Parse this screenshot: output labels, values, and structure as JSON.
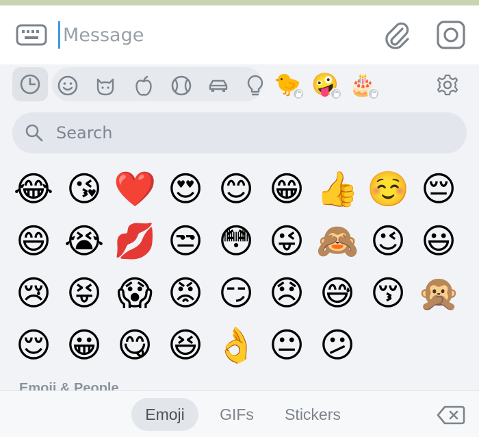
{
  "input": {
    "placeholder": "Message",
    "value": ""
  },
  "categories": {
    "recent_icon": "clock-icon",
    "items": [
      "smiley-icon",
      "cat-icon",
      "apple-icon",
      "ball-icon",
      "car-icon",
      "lightbulb-icon"
    ],
    "packs": [
      {
        "name": "duck-pack",
        "glyph": "🐤",
        "locked": true
      },
      {
        "name": "blob-pack",
        "glyph": "🤪",
        "locked": true
      },
      {
        "name": "happy-bday-pack",
        "glyph": "🎂",
        "locked": true
      }
    ]
  },
  "search": {
    "placeholder": "Search"
  },
  "emojis": [
    "😂",
    "😘",
    "❤️",
    "😍",
    "😊",
    "😁",
    "👍",
    "☺️",
    "😔",
    "😄",
    "😭",
    "💋",
    "😒",
    "😳",
    "😜",
    "🙈",
    "😉",
    "😃",
    "😢",
    "😝",
    "😱",
    "😡",
    "😏",
    "😞",
    "😅",
    "😚",
    "🙊",
    "😌",
    "😀",
    "😋",
    "😆",
    "👌",
    "😐",
    "😕"
  ],
  "section_label": "Emoji & People",
  "tabs": [
    {
      "label": "Emoji",
      "active": true
    },
    {
      "label": "GIFs",
      "active": false
    },
    {
      "label": "Stickers",
      "active": false
    }
  ],
  "colors": {
    "accent_cursor": "#3b9ce3",
    "panel_bg": "#f1f3f6",
    "icon_gray": "#8b939b"
  }
}
